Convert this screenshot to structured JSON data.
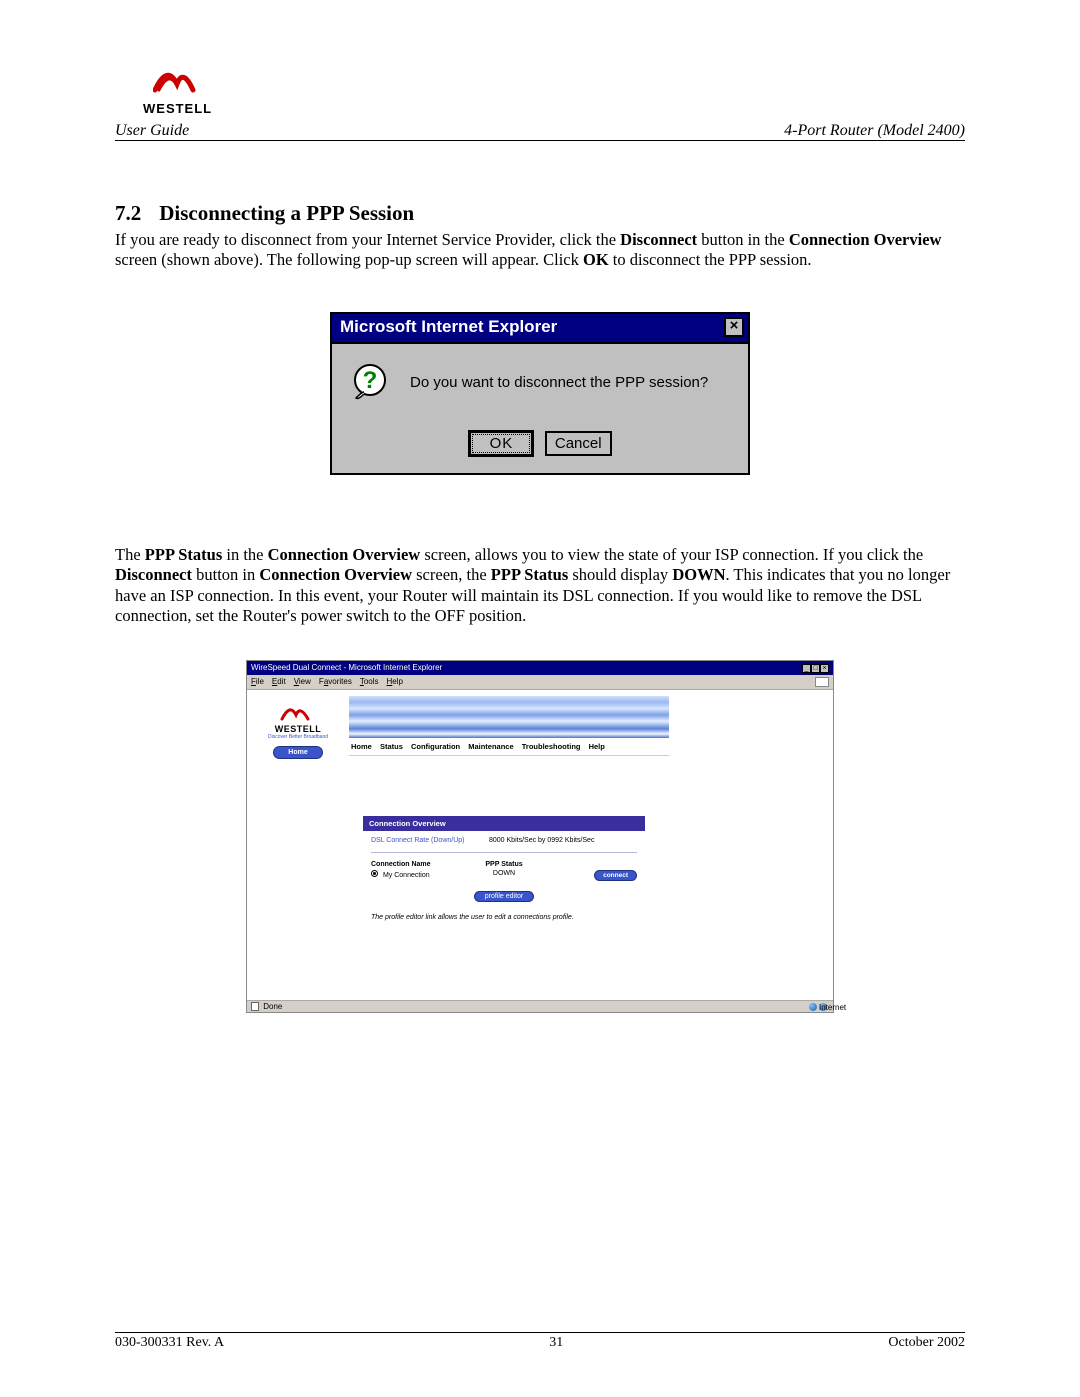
{
  "header": {
    "logo_text": "WESTELL",
    "left": "User Guide",
    "right": "4-Port Router (Model 2400)"
  },
  "section": {
    "num": "7.2",
    "title": "Disconnecting a PPP Session"
  },
  "para1": {
    "t1": "If you are ready to disconnect from your Internet Service Provider, click the ",
    "b1": "Disconnect",
    "t2": " button in the ",
    "b2": "Connection Overview",
    "t3": " screen (shown above). The following pop-up screen will appear. Click ",
    "b3": "OK",
    "t4": " to disconnect the PPP session."
  },
  "dialog": {
    "title": "Microsoft Internet Explorer",
    "close": "×",
    "message": "Do you want to disconnect the PPP session?",
    "ok": "OK",
    "cancel": "Cancel"
  },
  "para2": {
    "t1": "The ",
    "b1": "PPP Status",
    "t2": " in the ",
    "b2": "Connection Overview",
    "t3": " screen, allows you to view the state of your ISP connection. If you click the ",
    "b3": "Disconnect",
    "t4": " button in ",
    "b4": "Connection Overview",
    "t5": " screen, the ",
    "b5": "PPP Status",
    "t6": " should display ",
    "b6": "DOWN",
    "t7": ". This indicates that you no longer have an ISP connection. In this event, your Router will maintain its DSL connection. If you would like to remove the DSL connection, set the Router's power switch to the OFF position."
  },
  "browser": {
    "title": "WireSpeed Dual Connect - Microsoft Internet Explorer",
    "menu": {
      "file": "File",
      "edit": "Edit",
      "view": "View",
      "favorites": "Favorites",
      "tools": "Tools",
      "help": "Help"
    },
    "left": {
      "brand": "WESTELL",
      "tag": "Discover Better Broadband",
      "home": "Home"
    },
    "nav": {
      "home": "Home",
      "status": "Status",
      "config": "Configuration",
      "maint": "Maintenance",
      "trouble": "Troubleshooting",
      "help": "Help"
    },
    "panel_title": "Connection Overview",
    "dsl_label": "DSL Connect Rate (Down/Up)",
    "dsl_value": "8000 Kbits/Sec by 0992 Kbits/Sec",
    "col_name": "Connection Name",
    "col_status": "PPP Status",
    "conn_name": "My Connection",
    "conn_status": "DOWN",
    "connect_btn": "connect",
    "profile_btn": "profile editor",
    "note": "The profile editor link allows the user to edit a connections profile.",
    "status_left": "Done",
    "status_right": "Internet"
  },
  "footer": {
    "left": "030-300331 Rev. A",
    "center": "31",
    "right": "October 2002"
  }
}
